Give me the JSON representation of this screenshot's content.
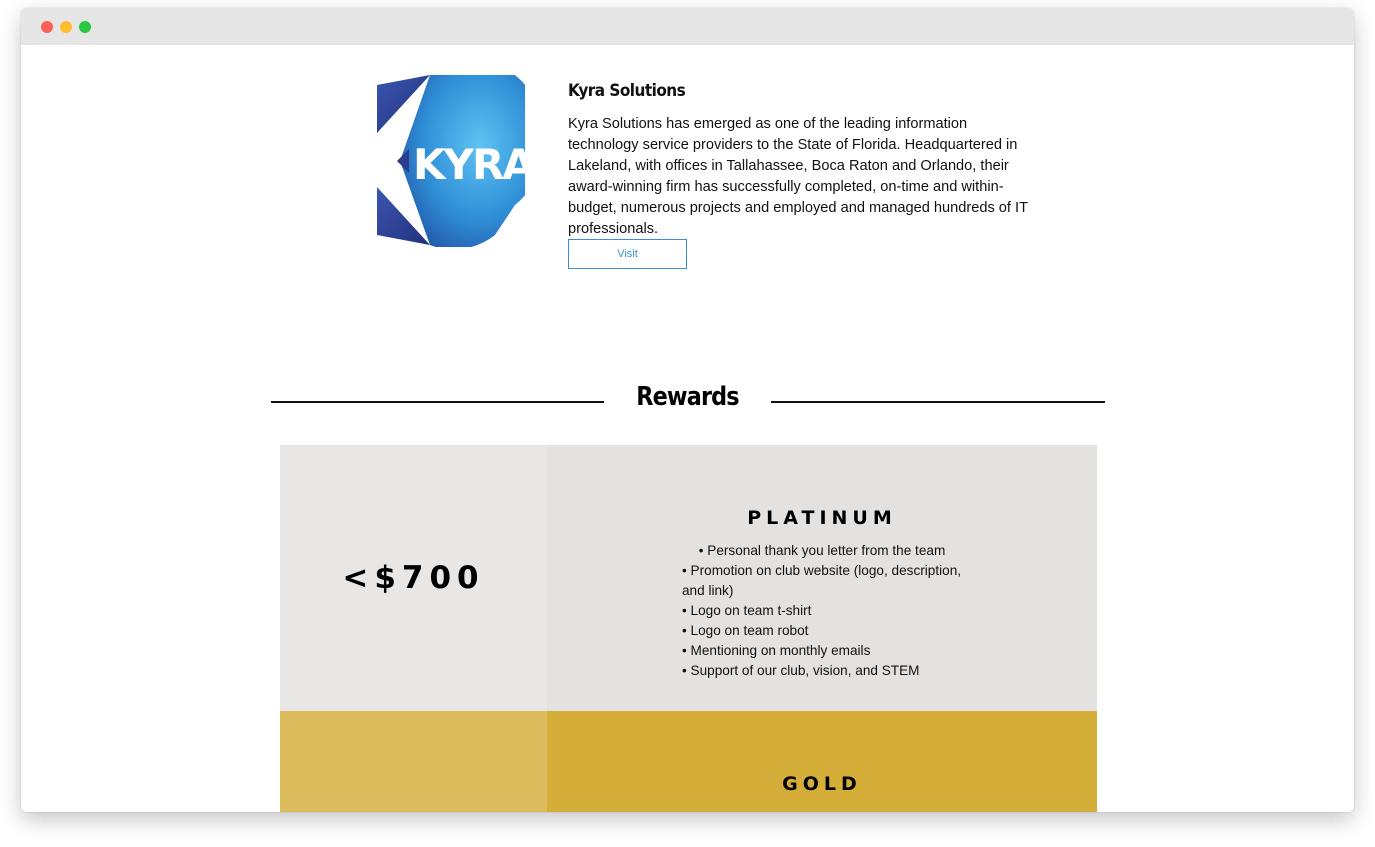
{
  "window": {
    "controls": [
      "close",
      "minimize",
      "zoom"
    ]
  },
  "sponsor": {
    "logo_text": "KYRA",
    "name": "Kyra Solutions",
    "description": "Kyra Solutions has emerged as one of the leading information technology service providers to the State of Florida. Headquartered in Lakeland, with offices in Tallahassee, Boca Raton and Orlando, their award-winning firm has successfully completed, on-time and within-budget, numerous projects and employed and managed hundreds of IT professionals.",
    "visit_label": "Visit"
  },
  "rewards": {
    "title": "Rewards",
    "tiers": [
      {
        "price": "<$700",
        "name": "PLATINUM",
        "price_bg": "#e8e7e6",
        "body_bg": "#e3e2e0",
        "benefits": [
          "• Personal thank you letter from the team",
          "• Promotion on club website (logo, description, and link)",
          "• Logo on team t-shirt",
          "• Logo on team robot",
          "• Mentioning on monthly emails",
          "• Support of our club, vision, and STEM"
        ]
      },
      {
        "price": "",
        "name": "GOLD",
        "price_bg": "#dcbc5c",
        "body_bg": "#d4ae38",
        "benefits": []
      }
    ]
  },
  "colors": {
    "accent_blue": "#3a8fd6",
    "logo_dark_blue": "#2a3a8c",
    "logo_light_blue": "#3a9fdf"
  }
}
